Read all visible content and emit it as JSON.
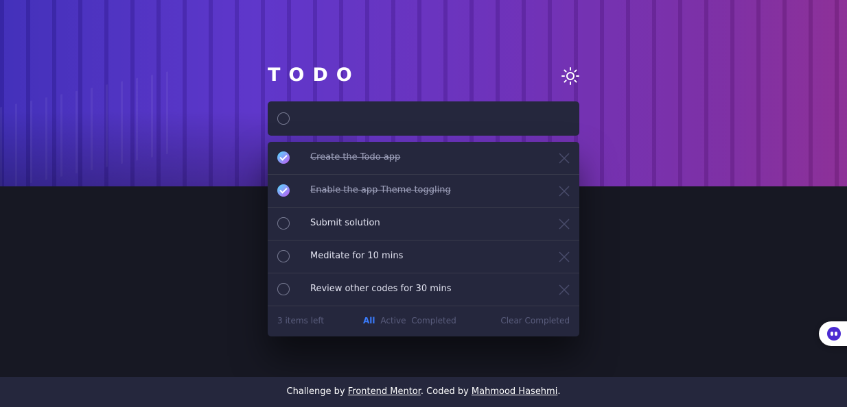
{
  "app": {
    "title": "TODO",
    "theme_toggle_icon": "sun-icon"
  },
  "new_todo": {
    "placeholder": "",
    "value": ""
  },
  "todos": [
    {
      "text": "Create the Todo app",
      "completed": true
    },
    {
      "text": "Enable the app Theme toggling",
      "completed": true
    },
    {
      "text": "Submit solution",
      "completed": false
    },
    {
      "text": "Meditate for 10 mins",
      "completed": false
    },
    {
      "text": "Review other codes for 30 mins",
      "completed": false
    }
  ],
  "list_footer": {
    "items_left": "3 items left",
    "filters": [
      "All",
      "Active",
      "Completed"
    ],
    "active_filter": "All",
    "clear_completed": "Clear Completed"
  },
  "site_footer": {
    "prefix": "Challenge by ",
    "link1": "Frontend Mentor",
    "middle": ". Coded by ",
    "link2": "Mahmood Hasehmi",
    "suffix": "."
  },
  "colors": {
    "accent": "#3a7cfd",
    "background": "#171823",
    "card": "#25273d",
    "check_gradient_start": "#55ddff",
    "check_gradient_end": "#c058f3"
  },
  "chat_widget_icon": "chat-bot-icon"
}
